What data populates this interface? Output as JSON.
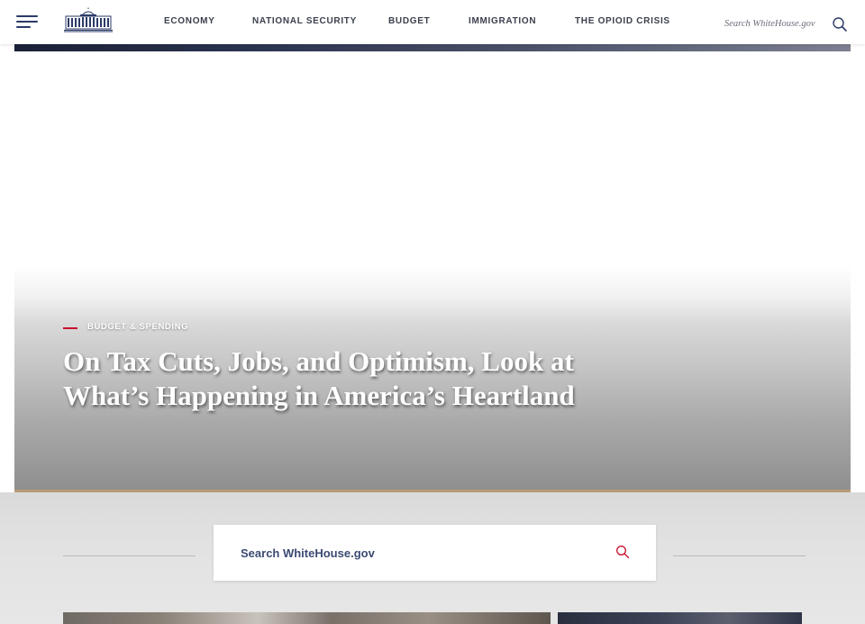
{
  "header": {
    "menu_icon": "hamburger-menu-icon",
    "logo_icon": "white-house-logo-icon",
    "nav": [
      {
        "label": "ECONOMY"
      },
      {
        "label": "NATIONAL SECURITY"
      },
      {
        "label": "BUDGET"
      },
      {
        "label": "IMMIGRATION"
      },
      {
        "label": "THE OPIOID CRISIS"
      }
    ],
    "search": {
      "placeholder": "Search WhiteHouse.gov",
      "icon": "search-icon"
    }
  },
  "hero": {
    "category": "BUDGET & SPENDING",
    "headline": "On Tax Cuts, Jobs, and Optimism, Look at What’s Happening in America’s Heartland"
  },
  "search_band": {
    "placeholder": "Search WhiteHouse.gov",
    "icon": "search-icon"
  },
  "colors": {
    "accent_red": "#c8102e",
    "navy": "#2b3a67",
    "gold_rule": "#b89b76"
  }
}
